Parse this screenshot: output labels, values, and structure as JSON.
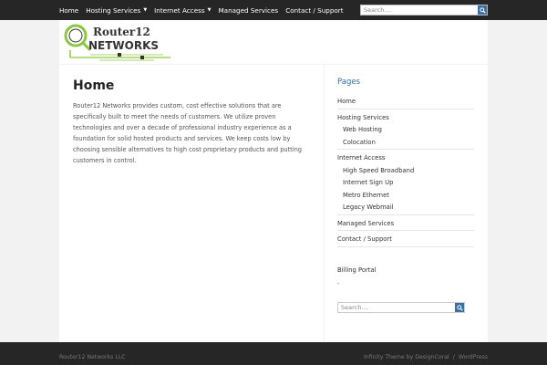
{
  "nav": {
    "items": [
      {
        "label": "Home",
        "dropdown": false
      },
      {
        "label": "Hosting Services",
        "dropdown": true
      },
      {
        "label": "Internet Access",
        "dropdown": true
      },
      {
        "label": "Managed Services",
        "dropdown": false
      },
      {
        "label": "Contact / Support",
        "dropdown": false
      }
    ],
    "caret": "▼"
  },
  "search_top": {
    "placeholder": "Search...."
  },
  "logo": {
    "line1": "Router12",
    "line2": "NETWORKS"
  },
  "main": {
    "title": "Home",
    "body": "Router12 Networks provides custom, cost effective solutions that are specifically built to meet the needs of customers.  We utilize proven technologies and over a decade of professional industry experience as a foundation for solid hosted products and services.  We keep costs low by choosing sensible alternatives to high cost proprietary products and putting customers in control."
  },
  "sidebar": {
    "title": "Pages",
    "items": [
      {
        "label": "Home",
        "sub": false
      },
      {
        "label": "Hosting Services",
        "sub": false
      },
      {
        "label": "Web Hosting",
        "sub": true
      },
      {
        "label": "Colocation",
        "sub": true
      },
      {
        "label": "Internet Access",
        "sub": false
      },
      {
        "label": "High Speed Broadband",
        "sub": true
      },
      {
        "label": "Internet Sign Up",
        "sub": true
      },
      {
        "label": "Metro Ethernet",
        "sub": true
      },
      {
        "label": "Legacy Webmail",
        "sub": true
      },
      {
        "label": "Managed Services",
        "sub": false
      },
      {
        "label": "Contact / Support",
        "sub": false
      }
    ],
    "billing": "Billing Portal",
    "dash": "-",
    "search_placeholder": "Search...."
  },
  "footer": {
    "left": "Router12 Networks LLC",
    "right_theme": "Infinity Theme by DesignCoral",
    "sep": "/",
    "right_wp": "WordPress"
  },
  "colors": {
    "accent": "#2f6ea5",
    "search_button": "#3a6fa7",
    "logo_green": "#8dc63f"
  }
}
